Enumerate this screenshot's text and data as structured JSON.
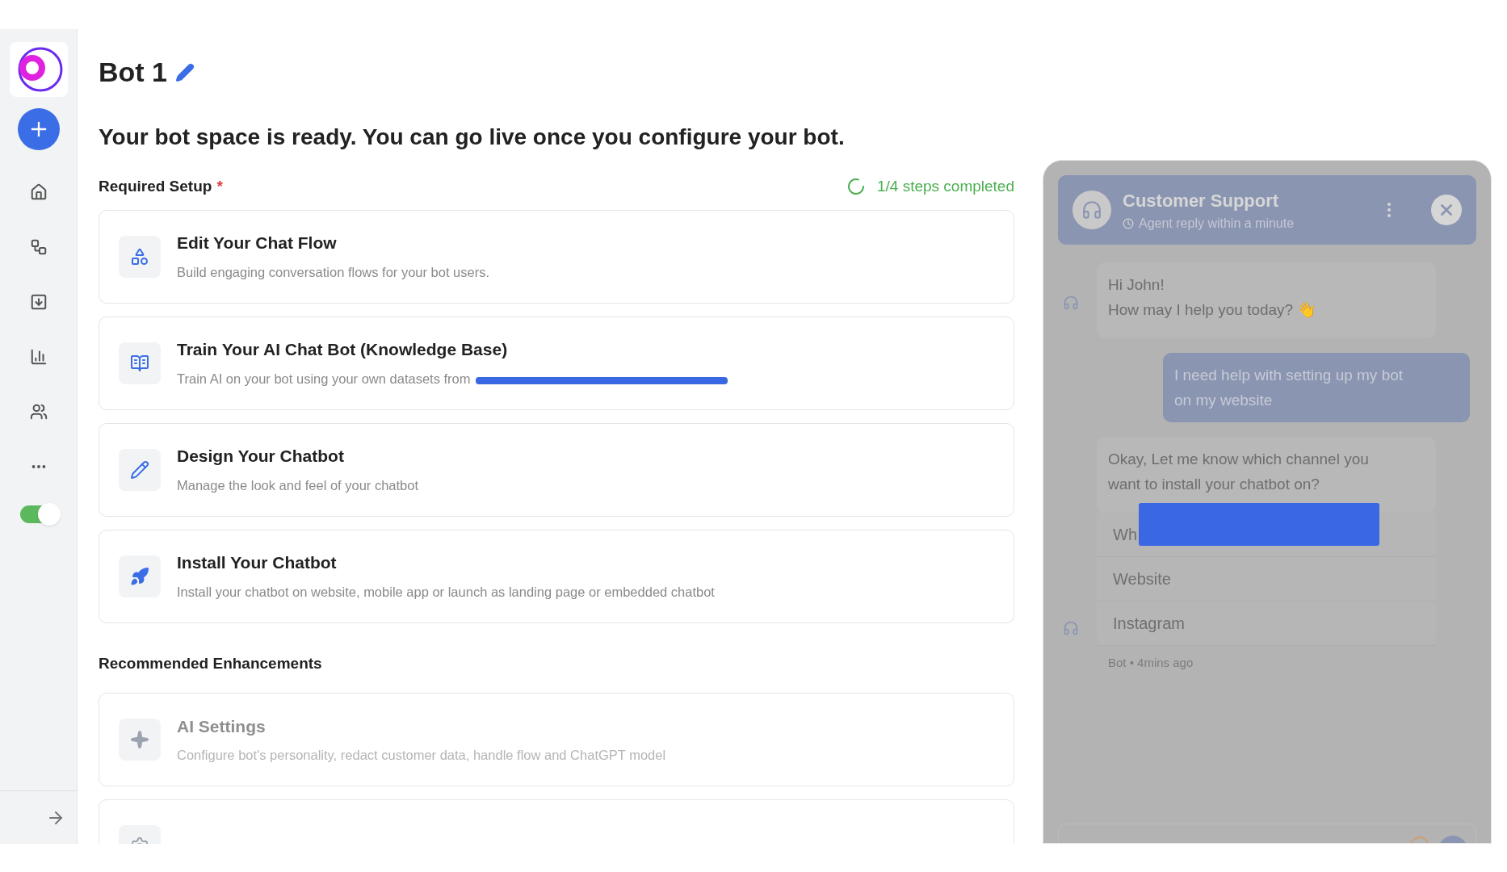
{
  "sidebar": {
    "toggle": {
      "on": true
    }
  },
  "title": "Bot 1",
  "headline": "Your bot space is ready. You can go live once you configure your bot.",
  "required_setup": {
    "label": "Required Setup",
    "required_mark": "*",
    "progress": "1/4 steps completed",
    "steps": [
      {
        "kind": "flow",
        "title": "Edit Your Chat Flow",
        "description": "Build engaging conversation flows for your bot users.",
        "redacted_link": false
      },
      {
        "kind": "knowledge",
        "title": "Train Your AI Chat Bot (Knowledge Base)",
        "description": "Train AI on your bot using your own datasets from",
        "redacted_link": true
      },
      {
        "kind": "design",
        "title": "Design Your Chatbot",
        "description": "Manage the look and feel of your chatbot",
        "redacted_link": false
      },
      {
        "kind": "install",
        "title": "Install Your Chatbot",
        "description": "Install your chatbot on website, mobile app or launch as landing page or embedded chatbot",
        "redacted_link": false
      }
    ]
  },
  "enhancements": {
    "label": "Recommended Enhancements",
    "items": [
      {
        "kind": "ai",
        "title": "AI Settings",
        "description": "Configure bot's personality, redact customer data, handle flow and ChatGPT model"
      },
      {
        "kind": "settings"
      }
    ]
  },
  "chat": {
    "title": "Customer Support",
    "subtitle": "Agent reply within a minute",
    "messages": [
      {
        "kind": "bot",
        "lines": [
          "Hi John!",
          "How may I help you today? 👋"
        ]
      },
      {
        "kind": "user",
        "lines": [
          "I need help with setting up my bot",
          "on my website"
        ]
      },
      {
        "kind": "bot",
        "lines": [
          "Okay, Let me know which channel you",
          "want to install your chatbot on?"
        ]
      }
    ],
    "options": [
      {
        "label": "Wh",
        "redacted": true
      },
      {
        "label": "Website",
        "redacted": false
      },
      {
        "label": "Instagram",
        "redacted": false
      }
    ],
    "meta": "Bot • 4mins ago"
  }
}
